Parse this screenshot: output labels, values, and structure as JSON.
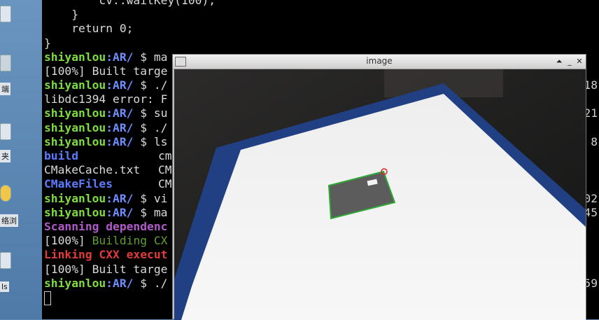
{
  "desktop": {
    "labels": [
      "端",
      "夹",
      "络浏",
      "ls"
    ]
  },
  "terminal": {
    "prompt_user": "shiyanlou",
    "prompt_path": ":AR/",
    "prompt_symbol": " $ ",
    "lines": {
      "l0": "        cv::waitKey(100);",
      "l1": "    }",
      "l2": "    return 0;",
      "l3": "}",
      "l4_cmd": "ma",
      "l5": "[100%] Built targe",
      "l6_cmd": "./",
      "l7": "libdc1394 error: F",
      "l8_cmd": "su",
      "l9_cmd": "./",
      "l10_cmd": "ls",
      "l11_a": "build",
      "l11_b": "cm",
      "l12_a": "CMakeCache.txt",
      "l12_b": "CM",
      "l13_a": "CMakeFiles",
      "l13_b": "CM",
      "l14_cmd": "vi",
      "l15_cmd": "ma",
      "l16": "Scanning dependenc",
      "l17_a": "[100%] ",
      "l17_b": "Building CX",
      "l18": "Linking CXX execut",
      "l19": "[100%] Built targe",
      "l20_cmd": "./"
    },
    "right_edge": [
      "18",
      "21",
      "8",
      "02",
      "45",
      "59"
    ]
  },
  "image_window": {
    "title": "image",
    "buttons": {
      "shade": "⏶",
      "minimize": "_",
      "close": "✕"
    }
  }
}
